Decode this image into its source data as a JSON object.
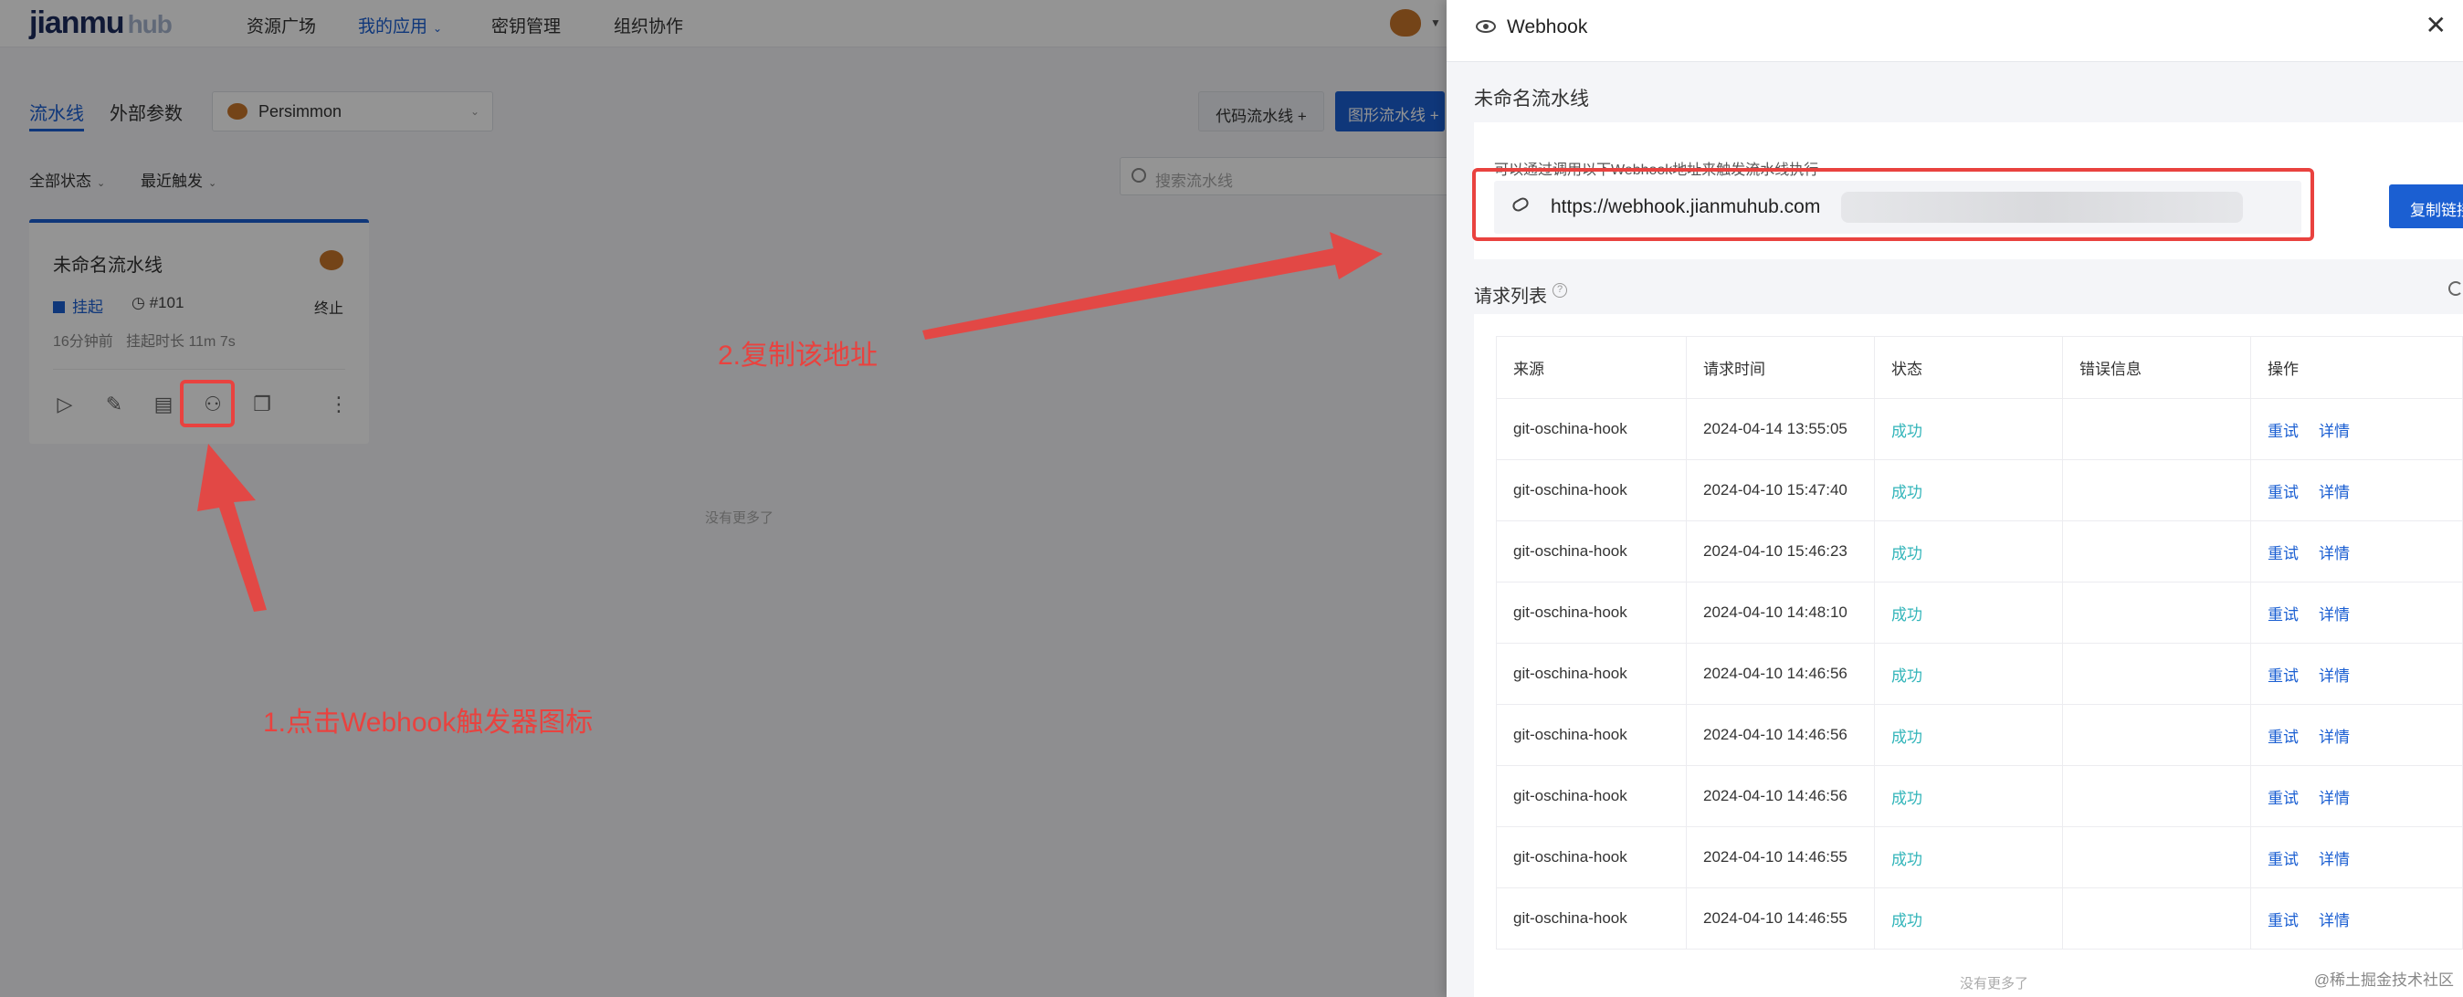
{
  "app": {
    "logo_main": "jianmu",
    "logo_sub": "hub",
    "nav": [
      "资源广场",
      "我的应用",
      "密钥管理",
      "组织协作"
    ],
    "subtabs": [
      "流水线",
      "外部参数"
    ],
    "project": "Persimmon",
    "btn_code": "代码流水线 +",
    "btn_graph": "图形流水线 +",
    "filter_status": "全部状态",
    "filter_trigger": "最近触发",
    "search_placeholder": "搜索流水线",
    "card": {
      "title": "未命名流水线",
      "status": "挂起",
      "run": "#101",
      "end": "终止",
      "time": "16分钟前",
      "duration": "挂起时长 11m 7s"
    },
    "no_more": "没有更多了"
  },
  "annotations": {
    "step1": "1.点击Webhook触发器图标",
    "step2": "2.复制该地址"
  },
  "drawer": {
    "title": "Webhook",
    "pipeline_name": "未命名流水线",
    "desc": "可以通过调用以下Webhook地址来触发流水线执行",
    "url": "https://webhook.jianmuhub.com",
    "copy_label": "复制链接",
    "request_list_title": "请求列表",
    "columns": [
      "来源",
      "请求时间",
      "状态",
      "错误信息",
      "操作"
    ],
    "retry_label": "重试",
    "detail_label": "详情",
    "rows": [
      {
        "source": "git-oschina-hook",
        "time": "2024-04-14 13:55:05",
        "status": "成功",
        "error": ""
      },
      {
        "source": "git-oschina-hook",
        "time": "2024-04-10 15:47:40",
        "status": "成功",
        "error": ""
      },
      {
        "source": "git-oschina-hook",
        "time": "2024-04-10 15:46:23",
        "status": "成功",
        "error": ""
      },
      {
        "source": "git-oschina-hook",
        "time": "2024-04-10 14:48:10",
        "status": "成功",
        "error": ""
      },
      {
        "source": "git-oschina-hook",
        "time": "2024-04-10 14:46:56",
        "status": "成功",
        "error": ""
      },
      {
        "source": "git-oschina-hook",
        "time": "2024-04-10 14:46:56",
        "status": "成功",
        "error": ""
      },
      {
        "source": "git-oschina-hook",
        "time": "2024-04-10 14:46:56",
        "status": "成功",
        "error": ""
      },
      {
        "source": "git-oschina-hook",
        "time": "2024-04-10 14:46:55",
        "status": "成功",
        "error": ""
      },
      {
        "source": "git-oschina-hook",
        "time": "2024-04-10 14:46:55",
        "status": "成功",
        "error": ""
      }
    ],
    "no_more": "没有更多了",
    "watermark": "@稀土掘金技术社区"
  }
}
